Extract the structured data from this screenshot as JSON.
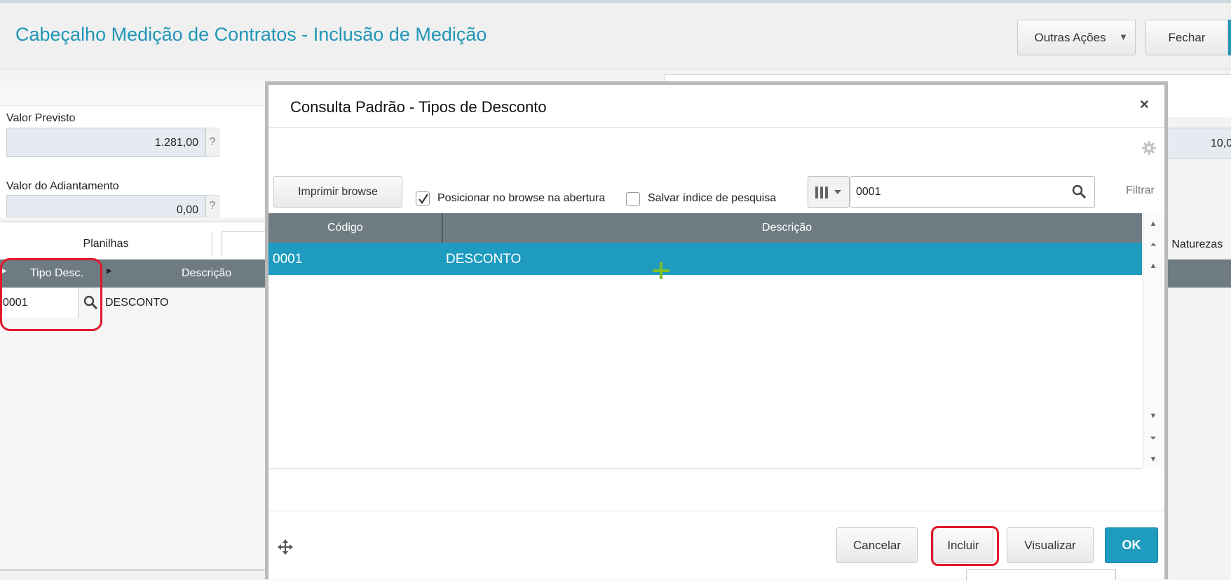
{
  "header": {
    "title": "Cabeçalho Medição de Contratos - Inclusão de Medição",
    "outras_acoes_label": "Outras Ações",
    "fechar_label": "Fechar"
  },
  "form": {
    "valor_previsto_label": "Valor Previsto",
    "valor_previsto_value": "1.281,00",
    "valor_adiantamento_label": "Valor do Adiantamento",
    "valor_adiantamento_value": "0,00",
    "help_label": "?",
    "right_value": "10,0"
  },
  "tabs": {
    "planilhas": "Planilhas",
    "naturezas": "t. Naturezas"
  },
  "grid": {
    "col_tipo_desc": "Tipo Desc.",
    "col_descricao": "Descrição",
    "row_code": "0001",
    "row_desc": "DESCONTO"
  },
  "modal": {
    "title": "Consulta Padrão - Tipos de Desconto",
    "close": "×",
    "print_label": "Imprimir browse",
    "chk_posicionar_label": "Posicionar no browse na abertura",
    "chk_posicionar_checked": true,
    "chk_salvar_label": "Salvar índice de pesquisa",
    "chk_salvar_checked": false,
    "search_value": "0001",
    "filtrar_label": "Filtrar",
    "table": {
      "headers": [
        "Código",
        "Descrição"
      ],
      "rows": [
        [
          "0001",
          "DESCONTO"
        ]
      ]
    },
    "footer": {
      "cancelar": "Cancelar",
      "incluir": "Incluir",
      "visualizar": "Visualizar",
      "ok": "OK"
    }
  },
  "colors": {
    "accent": "#2196b6",
    "selected_row": "#1e9bbf",
    "grid_header": "#6e7b82",
    "highlight": "#e0192b"
  }
}
